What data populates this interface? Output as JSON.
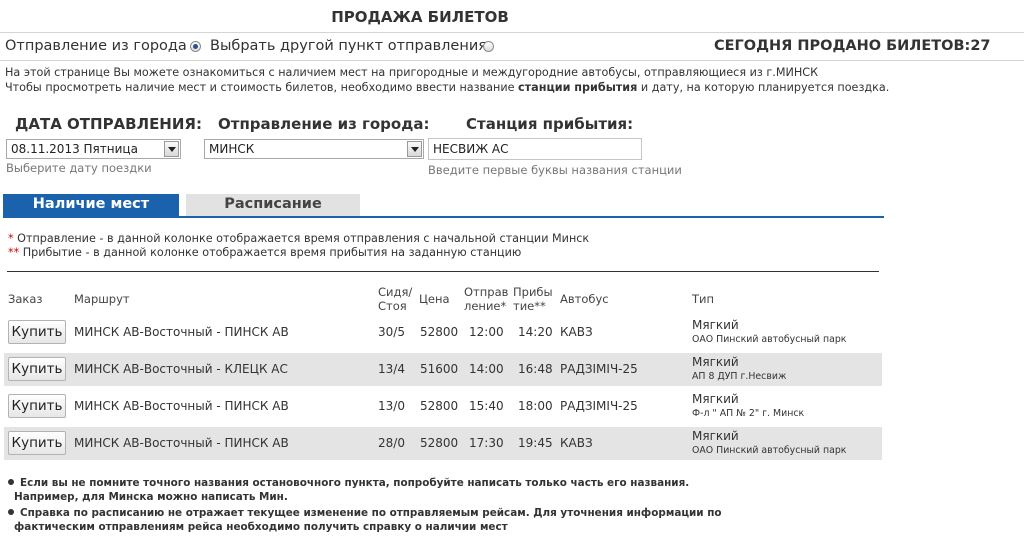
{
  "title": "ПРОДАЖА БИЛЕТОВ",
  "departure_mode": {
    "option1": "Отправление из города",
    "option2": "Выбрать другой пункт отправления",
    "selected": "option1"
  },
  "sold_today": "СЕГОДНЯ ПРОДАНО БИЛЕТОВ:27",
  "intro": {
    "line1": "На этой странице Вы можете ознакомиться с наличием мест на пригородные и междугородние автобусы, отправляющиеся из г.МИНСК",
    "line2_a": "Чтобы просмотреть наличие мест и стоимость билетов, необходимо ввести название ",
    "line2_b": "станции прибытия",
    "line2_c": " и дату, на которую планируется поездка."
  },
  "form": {
    "date_label": "ДАТА ОТПРАВЛЕНИЯ:",
    "date_value": "08.11.2013 Пятница",
    "date_hint": "Выберите дату поездки",
    "city_label": "Отправление из города:",
    "city_value": "МИНСК",
    "station_label": "Станция прибытия:",
    "station_value": "НЕСВИЖ АС",
    "station_hint": "Введите первые буквы названия станции"
  },
  "tabs": {
    "active": "Наличие мест",
    "inactive": "Расписание"
  },
  "notes": {
    "star1": "*",
    "text1": "  Отправление - в данной колонке отображается время отправления с начальной станции Минск",
    "star2": "**",
    "text2": " Прибытие - в данной колонке отображается время прибытия на заданную станцию"
  },
  "table": {
    "headers": {
      "order": "Заказ",
      "route": "Маршрут",
      "seats1": "Сидя/",
      "seats2": "Стоя",
      "price": "Цена",
      "dep1": "Отправ",
      "dep2": "ление*",
      "arr1": "Прибы",
      "arr2": "тие**",
      "bus": "Автобус",
      "type": "Тип"
    },
    "buy_label": "Купить",
    "rows": [
      {
        "route": "МИНСК АВ-Восточный - ПИНСК АВ",
        "seats": "30/5",
        "price": "52800",
        "dep": "12:00",
        "arr": "14:20",
        "bus": "КАВЗ",
        "type": "Мягкий",
        "carrier": "ОАО Пинский автобусный парк"
      },
      {
        "route": "МИНСК АВ-Восточный - КЛЕЦК АС",
        "seats": "13/4",
        "price": "51600",
        "dep": "14:00",
        "arr": "16:48",
        "bus": "РАДЗІМІЧ-25",
        "type": "Мягкий",
        "carrier": "АП 8 ДУП г.Несвиж"
      },
      {
        "route": "МИНСК АВ-Восточный - ПИНСК АВ",
        "seats": "13/0",
        "price": "52800",
        "dep": "15:40",
        "arr": "18:00",
        "bus": "РАДЗІМІЧ-25",
        "type": "Мягкий",
        "carrier": "Ф-л \" АП № 2\" г. Минск"
      },
      {
        "route": "МИНСК АВ-Восточный - ПИНСК АВ",
        "seats": "28/0",
        "price": "52800",
        "dep": "17:30",
        "arr": "19:45",
        "bus": "КАВЗ",
        "type": "Мягкий",
        "carrier": "ОАО Пинский автобусный парк"
      }
    ]
  },
  "footer": {
    "line1": "Если вы не помните точного названия остановочного пункта, попробуйте написать только часть его названия.",
    "line2": "Например, для Минска можно написать Мин.",
    "line3": "Справка по расписанию не отражает текущее изменение по отправляемым рейсам. Для уточнения информации по",
    "line4": "фактическим отправлениям рейса необходимо получить справку о наличии мест"
  },
  "colors": {
    "accent": "#1a63ac",
    "row_shade": "#e4e4e4",
    "note_star": "#cc0000"
  }
}
